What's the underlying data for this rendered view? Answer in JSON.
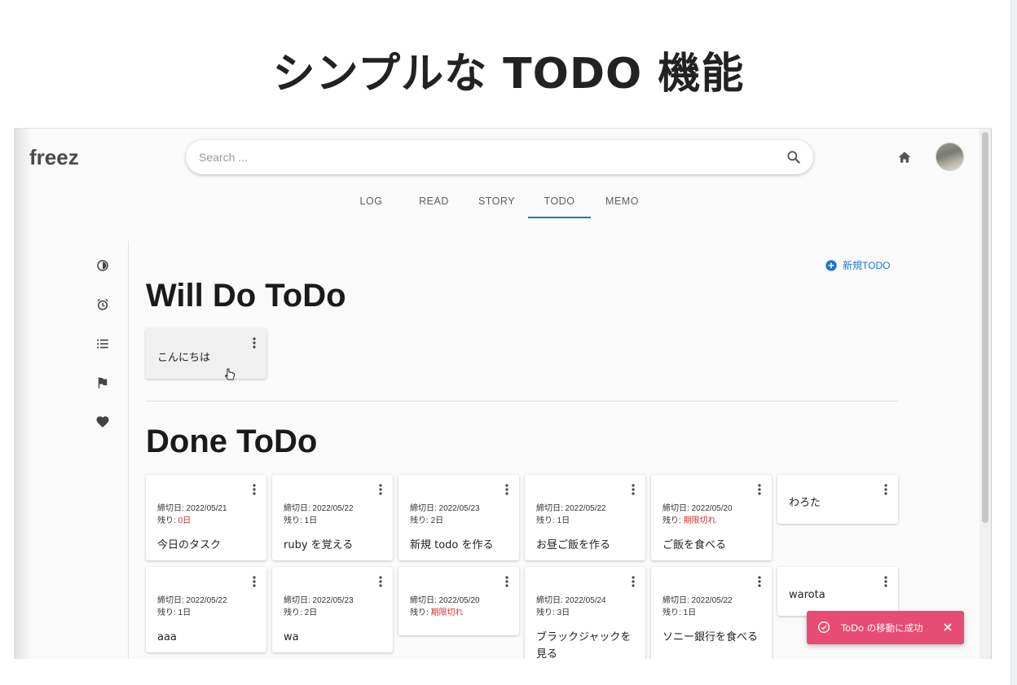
{
  "slide": {
    "title": "シンプルな TODO 機能"
  },
  "app": {
    "logo": "freez",
    "search": {
      "placeholder": "Search ...",
      "value": ""
    },
    "tabs": [
      {
        "label": "LOG",
        "active": false
      },
      {
        "label": "READ",
        "active": false
      },
      {
        "label": "STORY",
        "active": false
      },
      {
        "label": "TODO",
        "active": true
      },
      {
        "label": "MEMO",
        "active": false
      }
    ],
    "sidebar_icons": [
      "contrast-icon",
      "alarm-icon",
      "list-icon",
      "flag-icon",
      "heart-icon"
    ],
    "accent_color": "#1976d2",
    "new_todo_label": "新規TODO",
    "will_do": {
      "heading": "Will Do ToDo",
      "cards": [
        {
          "title": "こんにちは"
        }
      ]
    },
    "done": {
      "heading": "Done ToDo",
      "cards": [
        {
          "due": "締切日: 2022/05/21",
          "remaining_label": "残り:",
          "remaining": "0日",
          "overdue": true,
          "title": "今日のタスク"
        },
        {
          "due": "締切日: 2022/05/22",
          "remaining_label": "残り:",
          "remaining": "1日",
          "overdue": false,
          "title": "ruby を覚える"
        },
        {
          "due": "締切日: 2022/05/23",
          "remaining_label": "残り:",
          "remaining": "2日",
          "overdue": false,
          "title": "新規 todo を作る"
        },
        {
          "due": "締切日: 2022/05/22",
          "remaining_label": "残り:",
          "remaining": "1日",
          "overdue": false,
          "title": "お昼ご飯を作る"
        },
        {
          "due": "締切日: 2022/05/20",
          "remaining_label": "残り:",
          "remaining": "期限切れ",
          "overdue": true,
          "title": "ご飯を食べる"
        },
        {
          "title": "わろた"
        },
        {
          "due": "締切日: 2022/05/22",
          "remaining_label": "残り:",
          "remaining": "1日",
          "overdue": false,
          "title": "aaa"
        },
        {
          "due": "締切日: 2022/05/23",
          "remaining_label": "残り:",
          "remaining": "2日",
          "overdue": false,
          "title": "wa"
        },
        {
          "due": "締切日: 2022/05/20",
          "remaining_label": "残り:",
          "remaining": "期限切れ",
          "overdue": true,
          "title": ""
        },
        {
          "due": "締切日: 2022/05/24",
          "remaining_label": "残り:",
          "remaining": "3日",
          "overdue": false,
          "title": "ブラックジャックを見る"
        },
        {
          "due": "締切日: 2022/05/22",
          "remaining_label": "残り:",
          "remaining": "1日",
          "overdue": false,
          "title": "ソニー銀行を食べる"
        },
        {
          "title": "warota"
        }
      ]
    },
    "toast": {
      "message": "ToDo の移動に成功",
      "color": "#e74c74"
    }
  }
}
